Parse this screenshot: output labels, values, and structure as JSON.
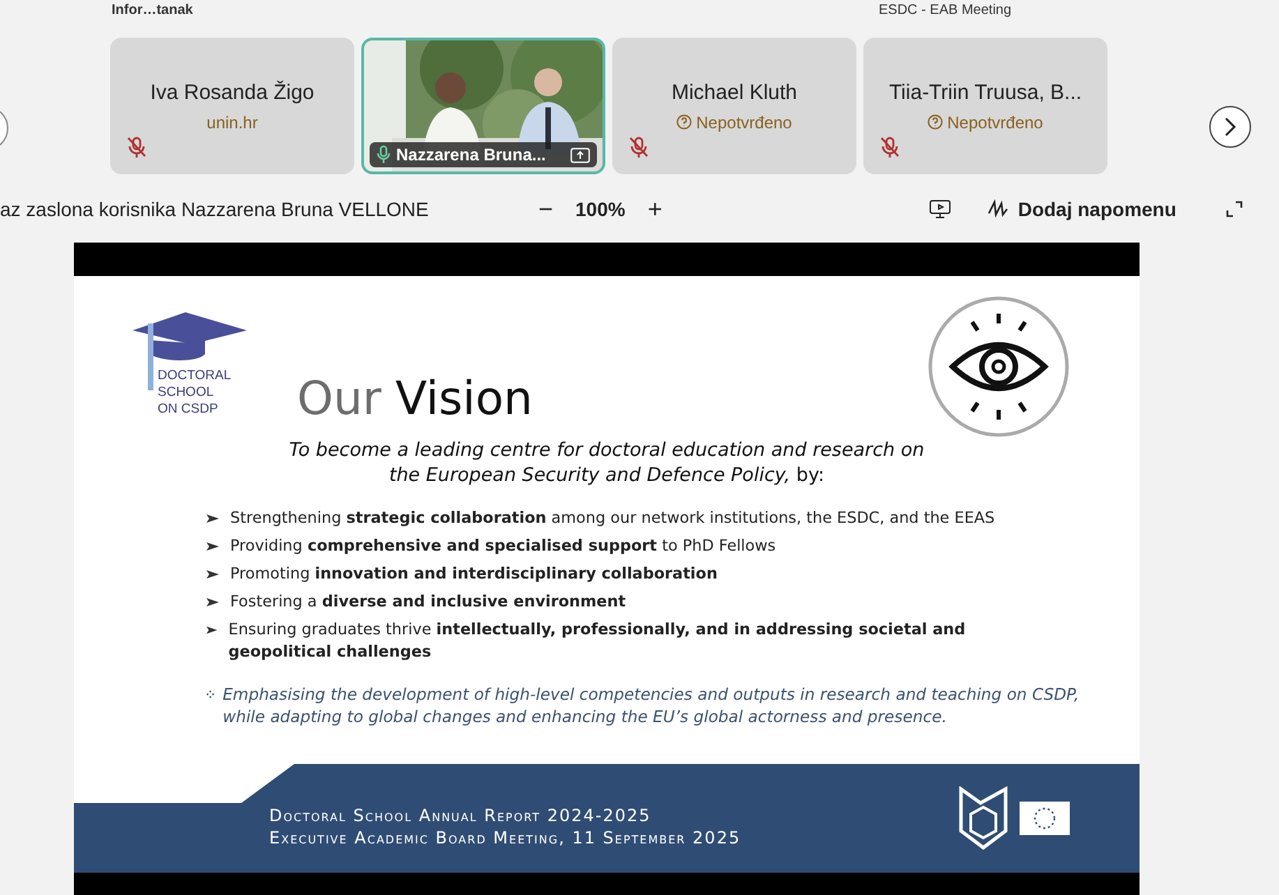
{
  "window": {
    "app_label": "Infor…tanak",
    "title": "ESDC - EAB Meeting"
  },
  "participants": [
    {
      "name": "Iva Rosanda Žigo",
      "subtitle": "unin.hr",
      "unconfirmed": false,
      "muted": true,
      "kind": "name",
      "selected": false
    },
    {
      "name": "Nazzarena Bruna...",
      "kind": "video",
      "muted": false,
      "selected": true
    },
    {
      "name": "Michael Kluth",
      "subtitle": "Nepotvrđeno",
      "unconfirmed": true,
      "muted": true,
      "kind": "name",
      "selected": false
    },
    {
      "name": "Tiia-Triin Truusa, B...",
      "subtitle": "Nepotvrđeno",
      "unconfirmed": true,
      "muted": true,
      "kind": "name",
      "selected": false
    }
  ],
  "share_bar": {
    "label": "az zaslona korisnika Nazzarena Bruna VELLONE",
    "zoom": "100%",
    "zoom_out": "−",
    "zoom_in": "+",
    "annotate": "Dodaj napomenu"
  },
  "slide": {
    "logo_lines": [
      "DOCTORAL",
      "SCHOOL",
      "ON CSDP"
    ],
    "title_first": "Our",
    "title_second": "Vision",
    "intro": "*To become a leading centre for doctoral education and research on the European Security and Defence Policy,* by:",
    "bullets": [
      "Strengthening **strategic collaboration** among our network institutions, the ESDC, and the EEAS",
      "Providing **comprehensive and specialised support** to PhD Fellows",
      "Promoting **innovation and interdisciplinary collaboration**",
      "Fostering a **diverse and inclusive environment**",
      "Ensuring graduates thrive **intellectually, professionally, and in addressing societal and geopolitical challenges**"
    ],
    "emphasis": "Emphasising the development of high-level competencies and outputs in research and teaching on CSDP, while adapting to global changes and enhancing the EU’s global actorness and presence.",
    "footer_lines": [
      "Doctoral School Annual Report 2024-2025",
      "Executive Academic Board Meeting, 11 September 2025"
    ]
  }
}
